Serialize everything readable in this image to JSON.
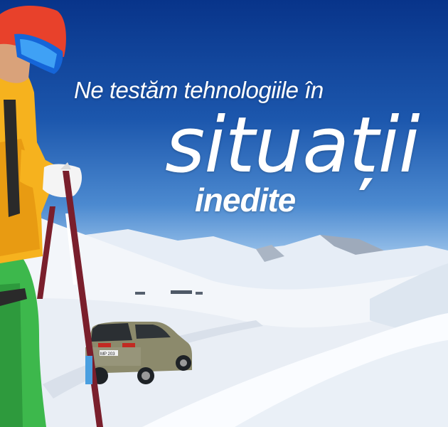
{
  "headline": {
    "line1": "Ne testăm tehnologiile în",
    "line2": "situații",
    "line3": "inedite"
  },
  "car": {
    "plate": "MP 203"
  },
  "colors": {
    "sky_top": "#08348a",
    "sky_horizon": "#b9d6f2",
    "snow": "#f4f7fb",
    "jacket": "#f6b21e",
    "pants": "#39b54a",
    "helmet": "#e8412b",
    "car_body": "#8a8a6e",
    "text": "#ffffff"
  },
  "icons": [
    "skier-figure",
    "ski-pole",
    "suv-car",
    "mountain-range"
  ]
}
